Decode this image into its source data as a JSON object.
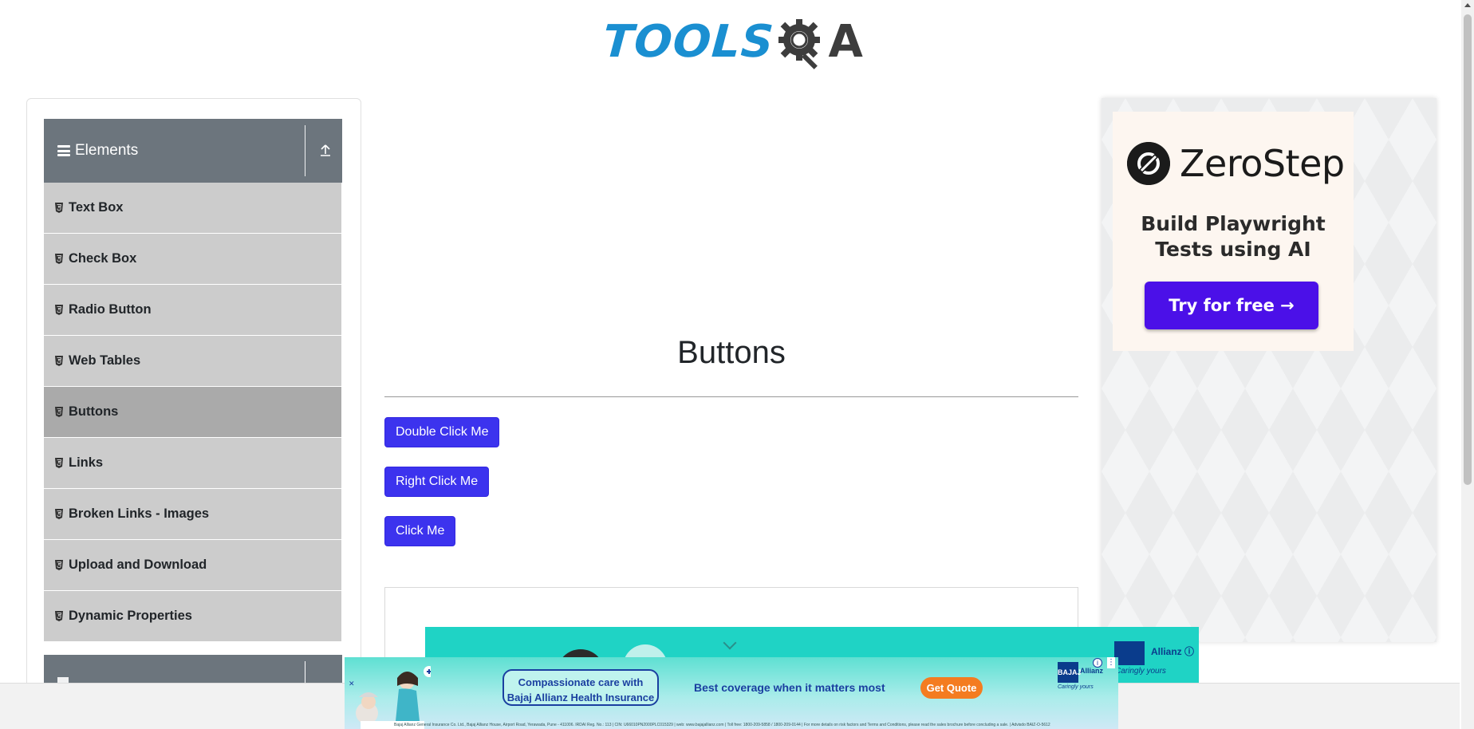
{
  "header": {
    "logo_text": "TOOLS",
    "logo_suffix": "A"
  },
  "sidebar": {
    "group_title": "Elements",
    "items": [
      {
        "label": "Text Box"
      },
      {
        "label": "Check Box"
      },
      {
        "label": "Radio Button"
      },
      {
        "label": "Web Tables"
      },
      {
        "label": "Buttons"
      },
      {
        "label": "Links"
      },
      {
        "label": "Broken Links - Images"
      },
      {
        "label": "Upload and Download"
      },
      {
        "label": "Dynamic Properties"
      }
    ],
    "active_item": "Buttons"
  },
  "main": {
    "title": "Buttons",
    "double_click_label": "Double Click Me",
    "right_click_label": "Right Click Me",
    "click_label": "Click Me"
  },
  "right_ad": {
    "brand": "ZeroStep",
    "headline_line1": "Build Playwright",
    "headline_line2": "Tests using AI",
    "cta": "Try for free →"
  },
  "bottom_ad": {
    "pill_line1": "Compassionate care with",
    "pill_line2": "Bajaj Allianz Health Insurance",
    "tagline": "Best coverage when it matters most",
    "cta": "Get Quote",
    "brand_mark": "BAJAJ",
    "brand_partner": "Allianz",
    "brand_tag": "Caringly yours",
    "fine_print": "Bajaj Allianz General Insurance Co. Ltd., Bajaj Allianz House, Airport Road, Yerawada, Pune - 411006. IRDAI Reg. No.: 113 | CIN: U66010PN2000PLC015329 | web: www.bajajallianz.com | Toll free: 1800-209-5858 / 1800-209-0144 | For more details on risk factors and Terms and Conditions, please read the sales brochure before concluding a sale. | Advisdo BAIZ-O-5612"
  },
  "colors": {
    "primary_button": "#3c33ee",
    "sidebar_header": "#6c757d",
    "sidebar_item": "#cccccc",
    "sidebar_item_active": "#aaaaaa",
    "logo_blue": "#1a8fd1",
    "ad_cta": "#4b10e8"
  }
}
